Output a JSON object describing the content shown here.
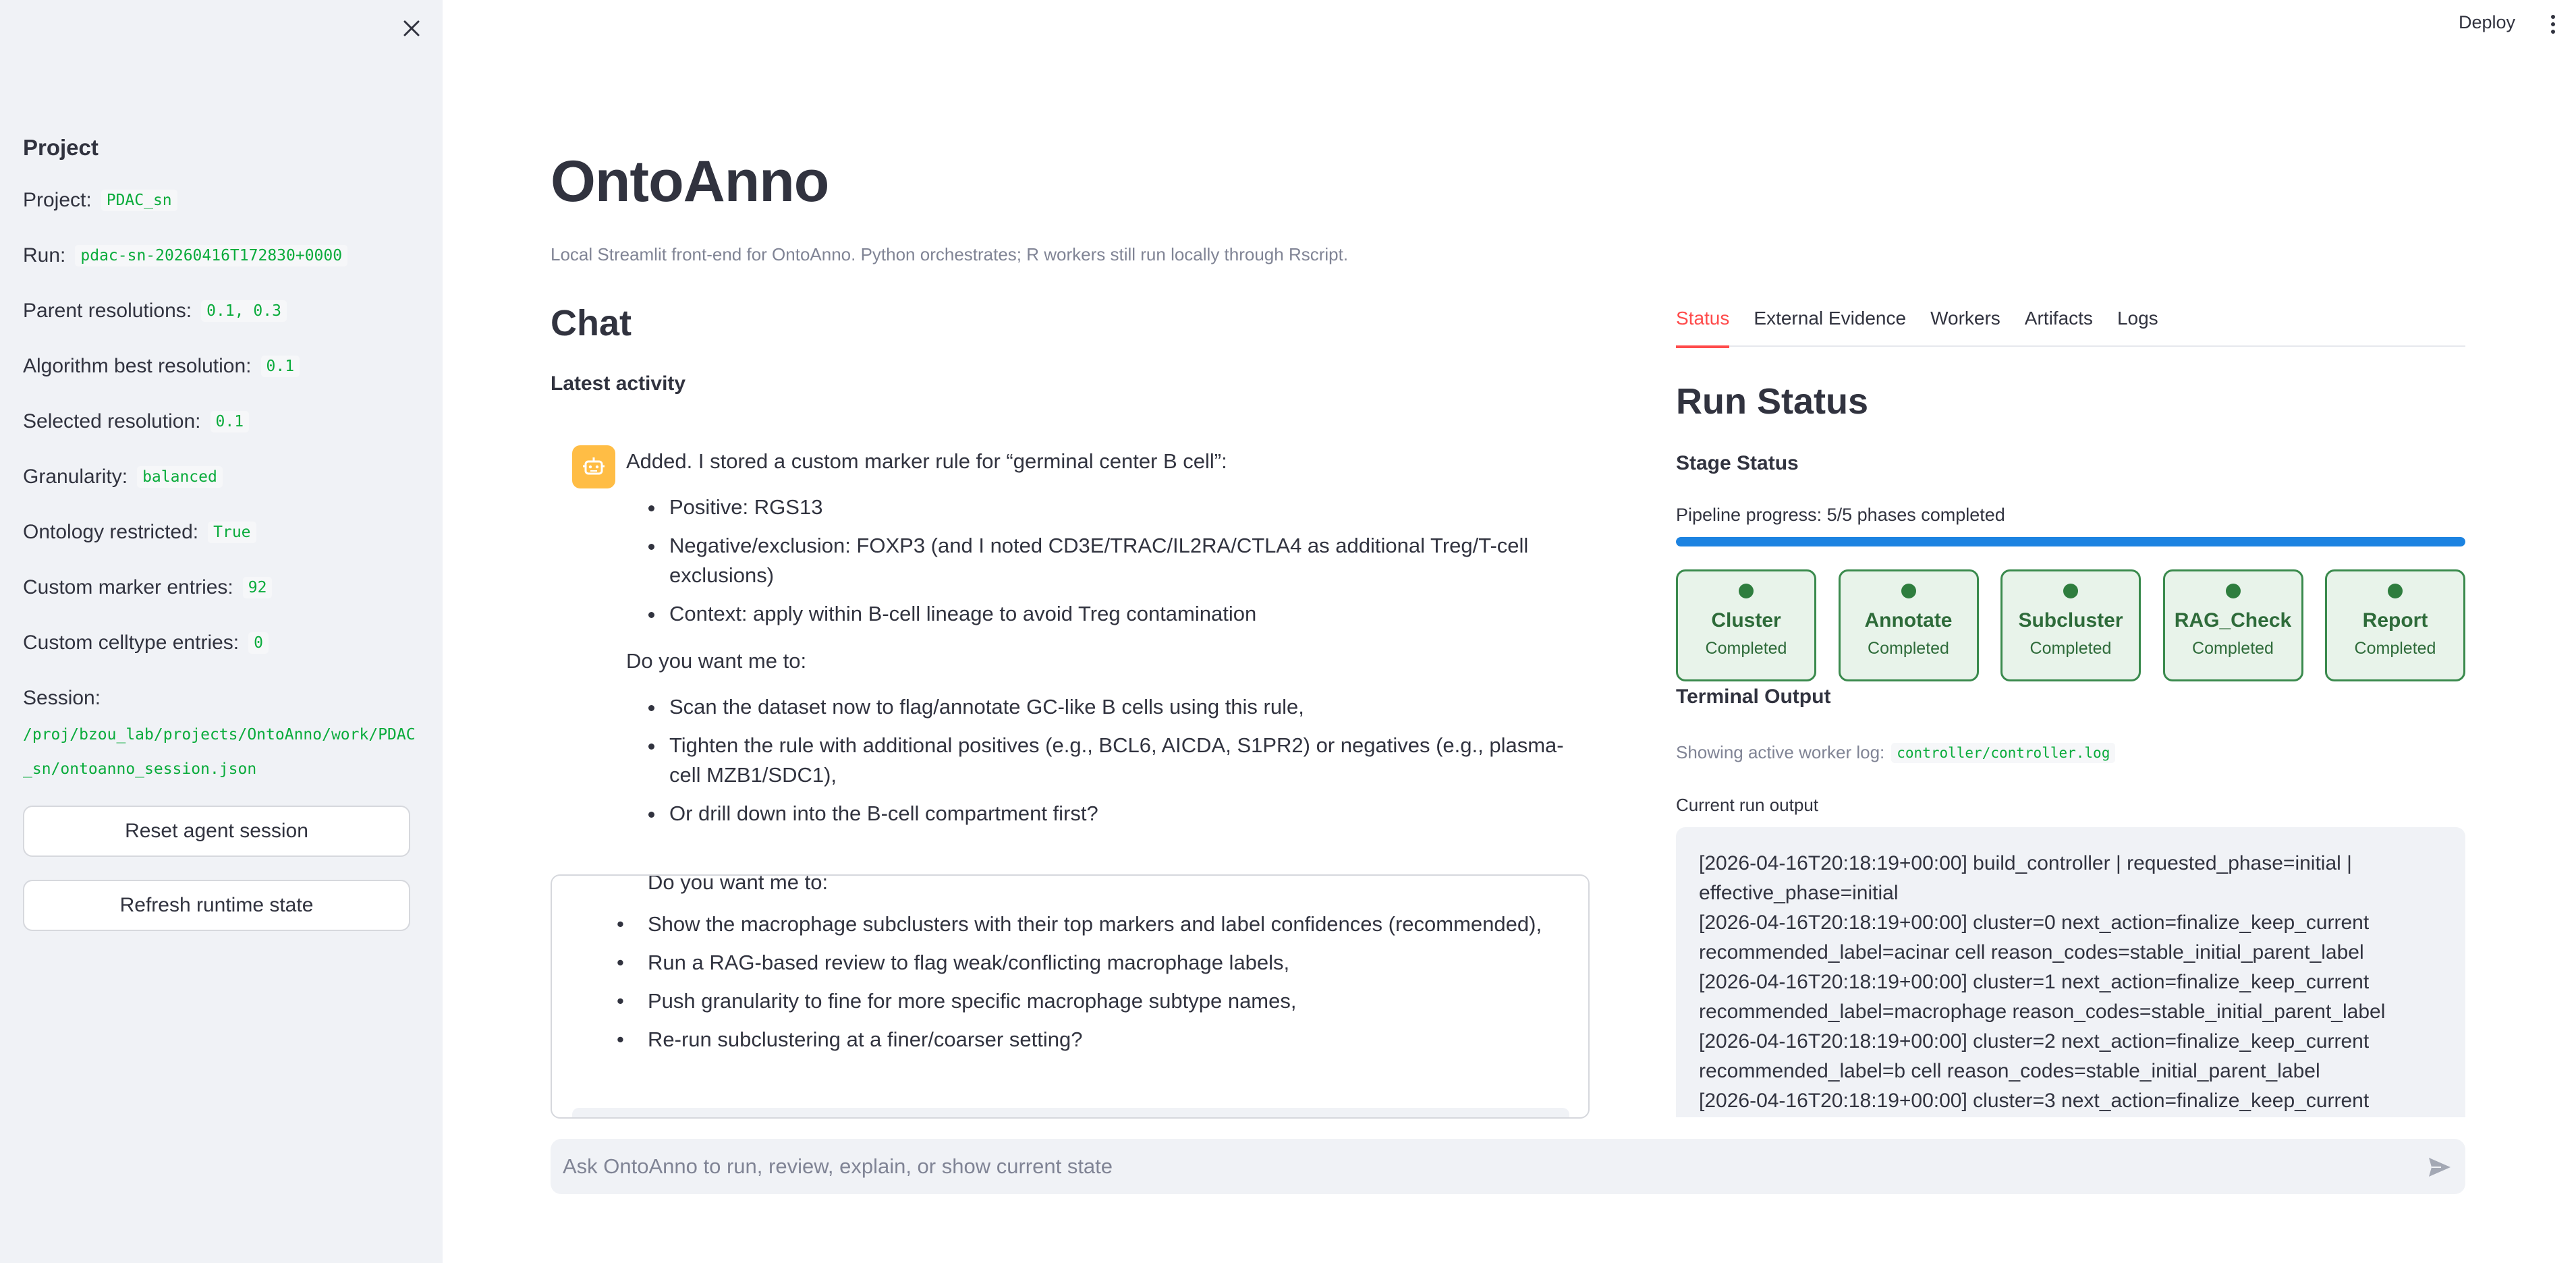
{
  "sidebar": {
    "title": "Project",
    "rows": [
      {
        "label": "Project:",
        "value": "PDAC_sn"
      },
      {
        "label": "Run:",
        "value": "pdac-sn-20260416T172830+0000"
      },
      {
        "label": "Parent resolutions:",
        "value": "0.1, 0.3"
      },
      {
        "label": "Algorithm best resolution:",
        "value": "0.1"
      },
      {
        "label": "Selected resolution:",
        "value": "0.1"
      },
      {
        "label": "Granularity:",
        "value": "balanced"
      },
      {
        "label": "Ontology restricted:",
        "value": "True"
      },
      {
        "label": "Custom marker entries:",
        "value": "92"
      },
      {
        "label": "Custom celltype entries:",
        "value": "0"
      }
    ],
    "session_label": "Session:",
    "session_path": "/proj/bzou_lab/projects/OntoAnno/work/PDAC_sn/ontoanno_session.json",
    "reset_button": "Reset agent session",
    "refresh_button": "Refresh runtime state"
  },
  "toolbar": {
    "deploy_label": "Deploy"
  },
  "main": {
    "title": "OntoAnno",
    "caption": "Local Streamlit front-end for OntoAnno. Python orchestrates; R workers still run locally through Rscript.",
    "chat_heading": "Chat",
    "latest_activity": "Latest activity",
    "message": {
      "intro": "Added. I stored a custom marker rule for “germinal center B cell”:",
      "bullets": [
        "Positive: RGS13",
        "Negative/exclusion: FOXP3 (and I noted CD3E/TRAC/IL2RA/CTLA4 as additional Treg/T-cell exclusions)",
        "Context: apply within B-cell lineage to avoid Treg contamination"
      ],
      "question": "Do you want me to:",
      "options": [
        "Scan the dataset now to flag/annotate GC-like B cells using this rule,",
        "Tighten the rule with additional positives (e.g., BCL6, AICDA, S1PR2) or negatives (e.g., plasma-cell MZB1/SDC1),",
        "Or drill down into the B-cell compartment first?"
      ]
    },
    "history": {
      "question": "Do you want me to:",
      "options": [
        "Show the macrophage subclusters with their top markers and label confidences (recommended),",
        "Run a RAG-based review to flag weak/conflicting macrophage labels,",
        "Push granularity to fine for more specific macrophage subtype names,",
        "Re-run subclustering at a finer/coarser setting?"
      ]
    },
    "chat_input_placeholder": "Ask OntoAnno to run, review, explain, or show current state"
  },
  "panel": {
    "tabs": [
      "Status",
      "External Evidence",
      "Workers",
      "Artifacts",
      "Logs"
    ],
    "active_tab": "Status",
    "run_status_heading": "Run Status",
    "stage_status_heading": "Stage Status",
    "pipeline_progress_text": "Pipeline progress: 5/5 phases completed",
    "pipeline_progress_fraction": 1.0,
    "stages": [
      {
        "name": "Cluster",
        "state": "Completed"
      },
      {
        "name": "Annotate",
        "state": "Completed"
      },
      {
        "name": "Subcluster",
        "state": "Completed"
      },
      {
        "name": "RAG_Check",
        "state": "Completed"
      },
      {
        "name": "Report",
        "state": "Completed"
      }
    ],
    "terminal_heading": "Terminal Output",
    "worker_log_label": "Showing active worker log:",
    "worker_log_path": "controller/controller.log",
    "current_output_label": "Current run output",
    "output_lines": [
      "[2026-04-16T20:18:19+00:00] build_controller | requested_phase=initial | effective_phase=initial",
      "[2026-04-16T20:18:19+00:00] cluster=0 next_action=finalize_keep_current recommended_label=acinar cell reason_codes=stable_initial_parent_label",
      "[2026-04-16T20:18:19+00:00] cluster=1 next_action=finalize_keep_current recommended_label=macrophage reason_codes=stable_initial_parent_label",
      "[2026-04-16T20:18:19+00:00] cluster=2 next_action=finalize_keep_current recommended_label=b cell reason_codes=stable_initial_parent_label",
      "[2026-04-16T20:18:19+00:00] cluster=3 next_action=finalize_keep_current"
    ]
  },
  "colors": {
    "accent": "#ff4b4b",
    "progress": "#1c83e1",
    "stage_success": "#2e7d3e",
    "code_text": "#09ab3b",
    "sidebar_bg": "#f0f2f6",
    "avatar_bg": "#ffbd45"
  },
  "icons": {
    "close": "close-icon",
    "menu": "kebab-menu-icon",
    "avatar": "robot-icon",
    "send": "send-icon"
  }
}
